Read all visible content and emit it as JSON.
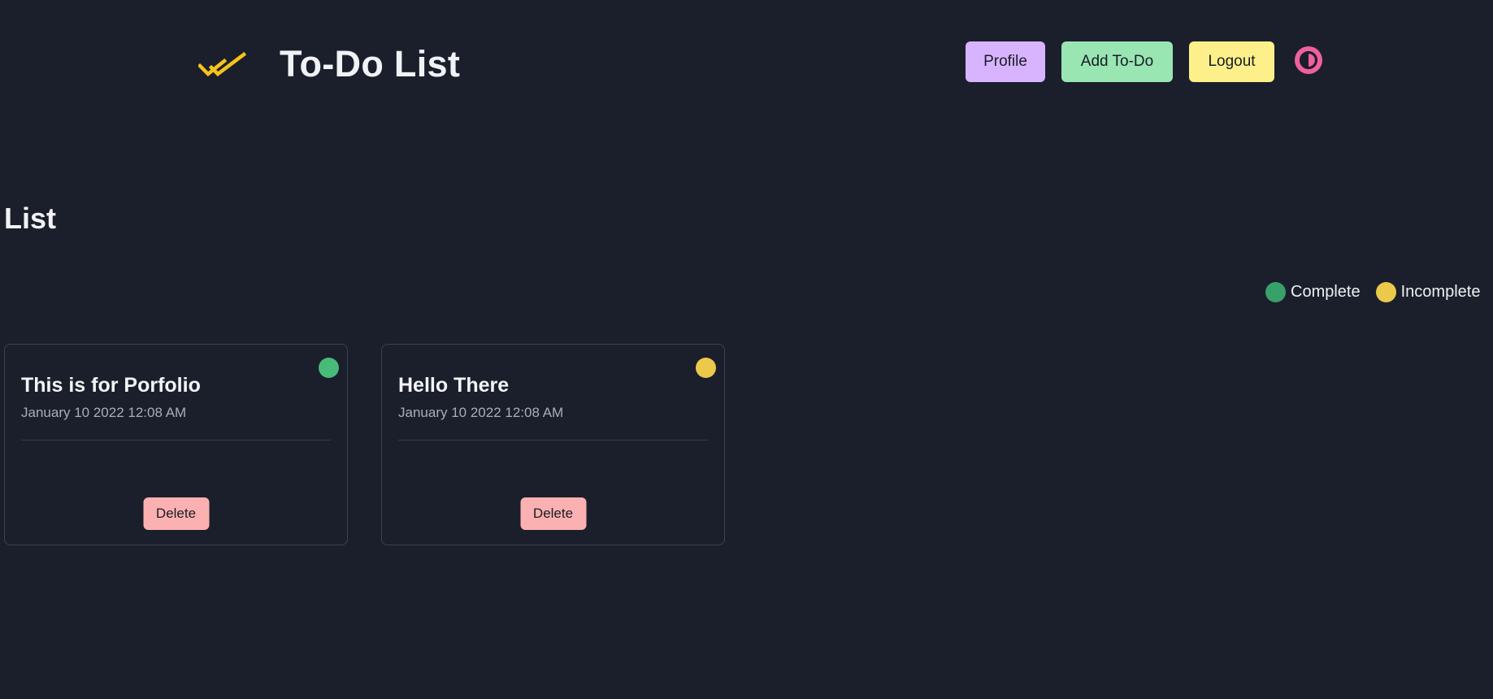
{
  "header": {
    "title": "To-Do List",
    "logo_icon": "double-check-icon",
    "logo_color": "#f6c21c"
  },
  "nav": {
    "profile_label": "Profile",
    "add_todo_label": "Add To-Do",
    "logout_label": "Logout",
    "theme_toggle_icon": "contrast-toggle-icon",
    "colors": {
      "profile": "#d8b4fe",
      "add_todo": "#99e6b3",
      "logout": "#fdf08a",
      "theme_toggle": "#f0609e"
    }
  },
  "list": {
    "heading": "List"
  },
  "legend": {
    "items": [
      {
        "label": "Complete",
        "color": "#38a169"
      },
      {
        "label": "Incomplete",
        "color": "#ecc94b"
      }
    ]
  },
  "todos": [
    {
      "title": "This is for Porfolio",
      "date": "January 10 2022 12:08 AM",
      "status": "Complete",
      "status_color": "#48bb78",
      "delete_label": "Delete"
    },
    {
      "title": "Hello There",
      "date": "January 10 2022 12:08 AM",
      "status": "Incomplete",
      "status_color": "#ecc94b",
      "delete_label": "Delete"
    }
  ]
}
